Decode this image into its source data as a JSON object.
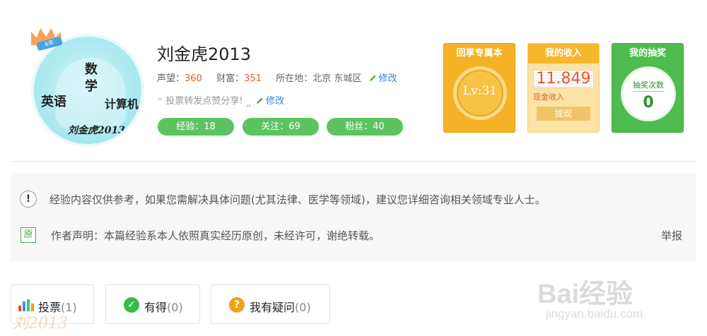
{
  "profile": {
    "username": "刘金虎2013",
    "avatar_words": {
      "top": "数",
      "top2": "学",
      "left": "英语",
      "right": "计算机",
      "bottom": "刘金虎2013"
    },
    "crown_badge": "6年",
    "reputation_label": "声望：",
    "reputation": "360",
    "wealth_label": "财富：",
    "wealth": "351",
    "location_label": "所在地：",
    "location": "北京 东城区",
    "edit_label": "修改",
    "motto": "投票转发点赞分享!",
    "motto_edit_label": "修改",
    "stats": [
      {
        "label": "经验：18"
      },
      {
        "label": "关注：69"
      },
      {
        "label": "粉丝：40"
      }
    ]
  },
  "cards": {
    "exclusive": {
      "title": "回享专属本",
      "level": "Lv:31"
    },
    "income": {
      "title": "我的收入",
      "amount": "11.849",
      "cash_label": "现金收入",
      "withdraw_label": "提现"
    },
    "lottery": {
      "title": "我的抽奖",
      "count_label": "抽奖次数",
      "count": "0"
    }
  },
  "notice": {
    "disclaimer": "经验内容仅供参考，如果您需解决具体问题(尤其法律、医学等领域)，建议您详细咨询相关领域专业人士。",
    "original_badge": "原",
    "author_statement": "作者声明：本篇经验系本人依照真实经历原创，未经许可，谢绝转载。",
    "report_label": "举报"
  },
  "actions": {
    "vote": {
      "label": "投票",
      "count": "(1)"
    },
    "useful": {
      "label": "有得",
      "count": "(0)"
    },
    "question": {
      "label": "我有疑问",
      "count": "(0)"
    }
  },
  "watermark": {
    "logo": "Bai经验",
    "url": "jingyan.baidu.com",
    "left_text": "刘2013"
  },
  "colors": {
    "accent_green": "#5cc45f",
    "number_orange": "#e85a2b",
    "link_blue": "#2e84d8",
    "gold": "#f4b227",
    "lottery_green": "#4ebc4e"
  }
}
